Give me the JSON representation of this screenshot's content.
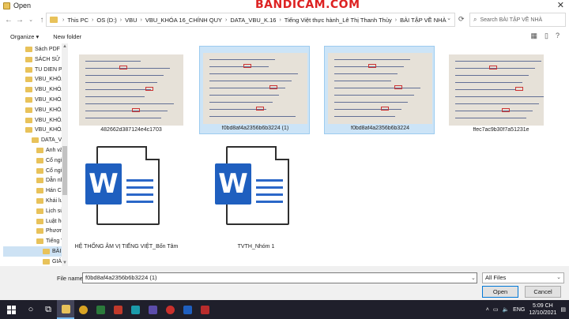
{
  "window": {
    "title": "Open"
  },
  "watermark": {
    "text_left": "BANDICAM",
    "text_right": ".COM"
  },
  "nav": {
    "crumbs": [
      "This PC",
      "OS (D:)",
      "VBU",
      "VBU_KHÓA 16_CHÍNH QUY",
      "DATA_VBU_K.16",
      "Tiếng Việt thực hành_Lê Thị Thanh Thủy",
      "BÀI TẬP VỀ NHÀ"
    ],
    "search_placeholder": "Search BÀI TẬP VỀ NHÀ"
  },
  "toolbar": {
    "organize": "Organize ▾",
    "new_folder": "New folder"
  },
  "sidebar": {
    "items": [
      {
        "label": "Sách PDF gi",
        "selected": false
      },
      {
        "label": "SÁCH SỬ Ph",
        "selected": false
      },
      {
        "label": "TU DIEN PAI",
        "selected": false
      },
      {
        "label": "VBU_KHÓA",
        "selected": false
      },
      {
        "label": "VBU_KHÓA",
        "selected": false
      },
      {
        "label": "VBU_KHÓA",
        "selected": false
      },
      {
        "label": "VBU_KHÓA",
        "selected": false
      },
      {
        "label": "VBU_KHÓA",
        "selected": false
      },
      {
        "label": "VBU_KHÓA",
        "selected": false
      },
      {
        "label": "DATA_VBU",
        "selected": false
      },
      {
        "label": "Anh văn",
        "selected": false
      },
      {
        "label": "Cổ ngữ F",
        "selected": false
      },
      {
        "label": "Cổ ngữ S",
        "selected": false
      },
      {
        "label": "Dẫn nhập",
        "selected": false
      },
      {
        "label": "Hán Cổ",
        "selected": false
      },
      {
        "label": "Khái luận",
        "selected": false
      },
      {
        "label": "Lịch sử P",
        "selected": false
      },
      {
        "label": "Luật học",
        "selected": false
      },
      {
        "label": "Phương p",
        "selected": false
      },
      {
        "label": "Tiếng Việ",
        "selected": false
      },
      {
        "label": "BÀI TẬ",
        "selected": true
      },
      {
        "label": "GIÁO TI",
        "selected": false
      }
    ]
  },
  "files": [
    {
      "name": "482662d387124e4c1703",
      "kind": "image",
      "selected": false
    },
    {
      "name": "f0bd8af4a2356b6b3224 (1)",
      "kind": "image",
      "selected": true
    },
    {
      "name": "f0bd8af4a2356b6b3224",
      "kind": "image",
      "selected": true
    },
    {
      "name": "ffec7ac9b30f7a51231e",
      "kind": "image",
      "selected": false
    },
    {
      "name": "HỆ THỐNG ÂM VỊ TIẾNG VIỆT_Bốn Tâm",
      "kind": "word",
      "selected": false
    },
    {
      "name": "TVTH_Nhóm 1",
      "kind": "word",
      "selected": false
    }
  ],
  "bottom": {
    "filename_label": "File name:",
    "filename_value": "f0bd8af4a2356b6b3224 (1)",
    "filetype_value": "All Files",
    "open_label": "Open",
    "cancel_label": "Cancel"
  },
  "taskbar": {
    "lang": "ENG",
    "time": "5:09 CH",
    "date": "12/10/2021"
  },
  "colors": {
    "accent": "#0078d7",
    "selection": "#cce4f7",
    "taskbar": "#1f1f2b",
    "word_blue": "#1f5fbf"
  }
}
